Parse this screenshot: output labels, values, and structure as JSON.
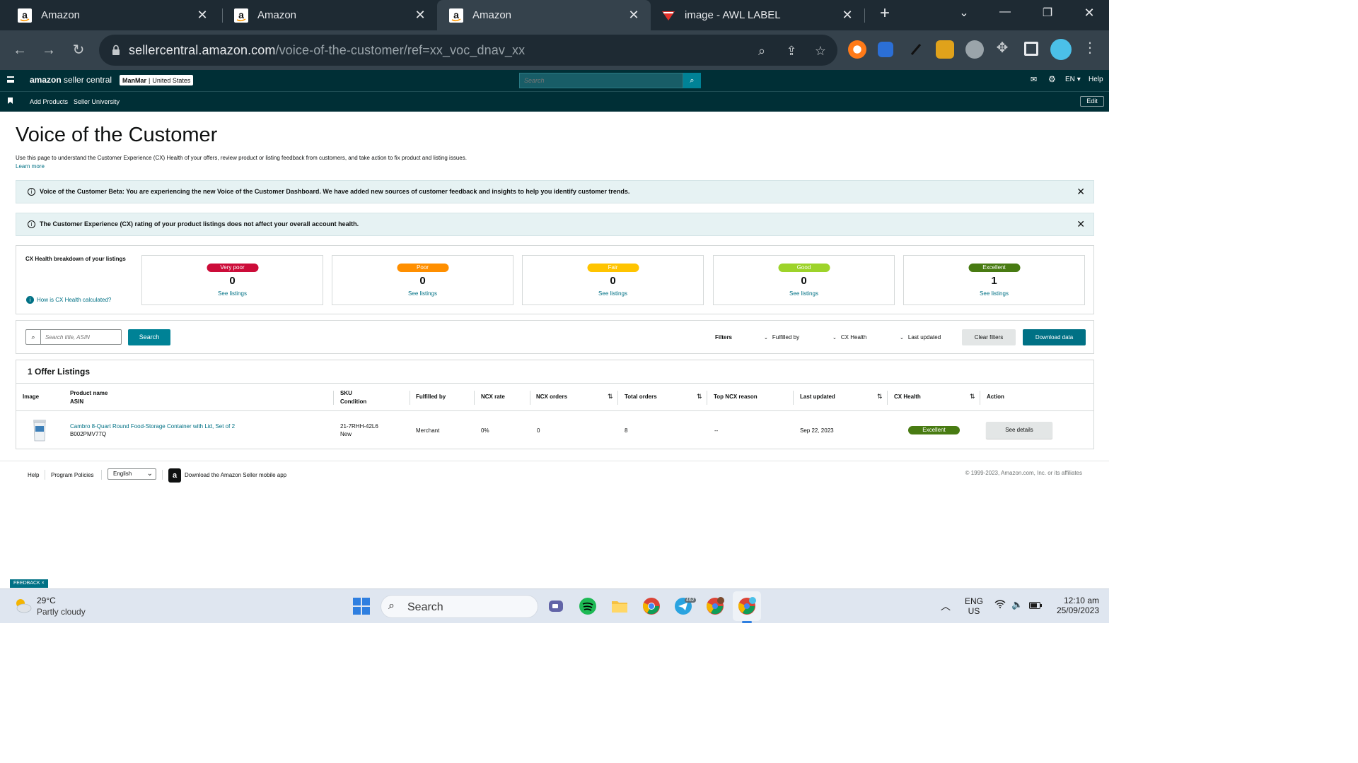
{
  "browser": {
    "tabs": [
      {
        "title": "Amazon",
        "active": false
      },
      {
        "title": "Amazon",
        "active": false
      },
      {
        "title": "Amazon",
        "active": true
      },
      {
        "title": "image - AWL LABEL",
        "active": false
      }
    ],
    "url_host": "sellercentral.amazon.com",
    "url_path": "/voice-of-the-customer/ref=xx_voc_dnav_xx"
  },
  "header": {
    "logo_brand": "amazon",
    "logo_product": "seller central",
    "store_name": "ManMar",
    "store_country": "United States",
    "search_placeholder": "Search",
    "lang": "EN",
    "help": "Help"
  },
  "subnav": {
    "links": [
      "Add Products",
      "Seller University"
    ],
    "edit": "Edit"
  },
  "page": {
    "title": "Voice of the Customer",
    "description": "Use this page to understand the Customer Experience (CX) Health of your offers, review product or listing feedback from customers, and take action to fix product and listing issues.",
    "learn_more": "Learn more"
  },
  "banners": [
    "Voice of the Customer Beta: You are experiencing the new Voice of the Customer Dashboard. We have added new sources of customer feedback and insights to help you identify customer trends.",
    "The Customer Experience (CX) rating of your product listings does not affect your overall account health."
  ],
  "cx_health": {
    "title": "CX Health breakdown of your listings",
    "help_link": "How is CX Health calculated?",
    "cards": [
      {
        "label": "Very poor",
        "count": "0",
        "link": "See listings",
        "color": "#cc0c39"
      },
      {
        "label": "Poor",
        "count": "0",
        "link": "See listings",
        "color": "#ff8f00"
      },
      {
        "label": "Fair",
        "count": "0",
        "link": "See listings",
        "color": "#ffc400"
      },
      {
        "label": "Good",
        "count": "0",
        "link": "See listings",
        "color": "#9dd32a"
      },
      {
        "label": "Excellent",
        "count": "1",
        "link": "See listings",
        "color": "#487b12"
      }
    ]
  },
  "filters": {
    "search_placeholder": "Search title, ASIN",
    "search_button": "Search",
    "filters_label": "Filters",
    "dropdowns": [
      "Fulfilled by",
      "CX Health",
      "Last updated"
    ],
    "clear_button": "Clear filters",
    "download_button": "Download data"
  },
  "listings": {
    "heading": "1 Offer Listings",
    "headers": {
      "image": "Image",
      "product_name": "Product name",
      "asin": "ASIN",
      "sku": "SKU",
      "condition": "Condition",
      "fulfilled_by": "Fulfilled by",
      "ncx_rate": "NCX rate",
      "ncx_orders": "NCX orders",
      "total_orders": "Total orders",
      "top_ncx_reason": "Top NCX reason",
      "last_updated": "Last updated",
      "cx_health": "CX Health",
      "action": "Action"
    },
    "rows": [
      {
        "product_name": "Cambro 8-Quart Round Food-Storage Container with Lid, Set of 2",
        "asin": "B002PMV77Q",
        "sku": "21-7RHH-42L6",
        "condition": "New",
        "fulfilled_by": "Merchant",
        "ncx_rate": "0%",
        "ncx_orders": "0",
        "total_orders": "8",
        "top_ncx_reason": "--",
        "last_updated": "Sep 22, 2023",
        "cx_health": "Excellent",
        "action": "See details"
      }
    ]
  },
  "footer": {
    "links": [
      "Help",
      "Program Policies"
    ],
    "language": "English",
    "app_text": "Download the Amazon Seller mobile app",
    "copyright": "© 1999-2023, Amazon.com, Inc. or its affiliates"
  },
  "feedback": "FEEDBACK ×",
  "taskbar": {
    "temp": "29°C",
    "weather": "Partly cloudy",
    "search": "Search",
    "telegram_badge": "462",
    "lang_line1": "ENG",
    "lang_line2": "US",
    "time": "12:10 am",
    "date": "25/09/2023"
  }
}
